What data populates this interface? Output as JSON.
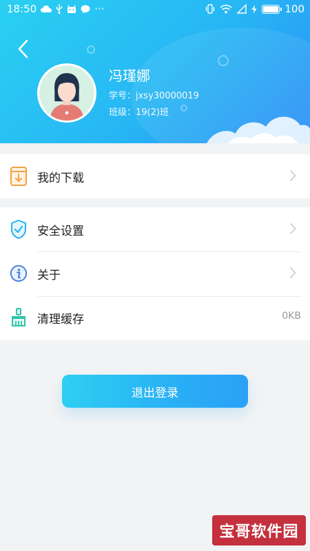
{
  "status_bar": {
    "time": "18:50",
    "more_dots": "···",
    "battery_level": "100"
  },
  "profile": {
    "name": "冯瑾娜",
    "student_id_line": "学号：jxsy30000019",
    "class_line": "班级：19(2)班"
  },
  "menu": {
    "downloads": {
      "label": "我的下载",
      "icon": "download-book-icon"
    },
    "security": {
      "label": "安全设置",
      "icon": "shield-check-icon"
    },
    "about": {
      "label": "关于",
      "icon": "info-icon"
    },
    "cache": {
      "label": "清理缓存",
      "value": "0KB",
      "icon": "broom-icon"
    }
  },
  "logout_button": {
    "label": "退出登录"
  },
  "watermark": {
    "text": "宝哥软件园"
  },
  "colors": {
    "header_start": "#2ad0f2",
    "header_end": "#2a8ef6",
    "download_icon": "#f0a343",
    "security_icon": "#2ab2f0",
    "about_icon": "#3f7ad8",
    "cache_icon": "#2ec3a8",
    "watermark_bg": "#c4303d"
  }
}
